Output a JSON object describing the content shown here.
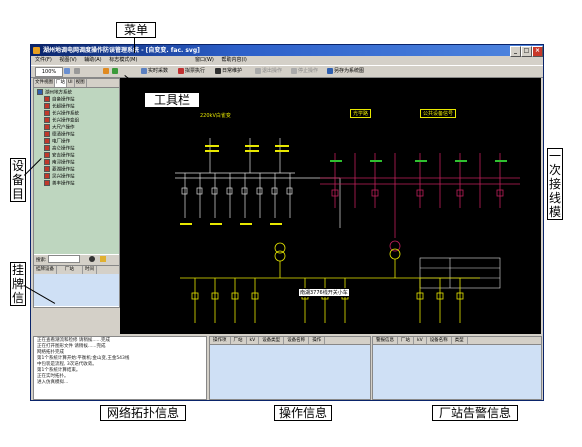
{
  "window": {
    "title": "湖州地调电网调度操作防误管理系统 - [自变变. fac. svg]"
  },
  "menu": [
    "文件(F)",
    "视图(V)",
    "辅助(A)",
    "标志模式(M)",
    "窗口(W)",
    "帮助内容(I)"
  ],
  "toolbar": {
    "zoom": "100%",
    "buttons": [
      "实时采数",
      "拟票执行",
      "日常维护",
      "退出操作",
      "停止操作",
      "另存为系统图"
    ]
  },
  "left_panel": {
    "tabs": [
      "文件视图",
      "厂站",
      "UI",
      "视图"
    ],
    "tree_root": "湖州地方系统",
    "tree_items": [
      "自备操作站",
      "长超操作站",
      "长兴操作系统",
      "长兴操作变组",
      "大尺户操作",
      "德清操作站",
      "电厂操作",
      "高仑操作站",
      "安吉操作站",
      "南浔操作站",
      "菱湖操作站",
      "吴兴操作站",
      "善丰操作站"
    ],
    "search_label": "搜索:",
    "tag_columns": [
      "挂牌设备",
      "厂站",
      "时间"
    ]
  },
  "diagram": {
    "title_left": "220kV白雀变",
    "tag_mid": "光学路",
    "tag_right": "公共设备信号",
    "popup": "南湖3776线开关小车"
  },
  "log": {
    "lines": [
      "正在查看潮流和检修 请稍候......完成",
      "正在打开图形文件 请稍候......完成",
      "网络拓扑完成",
      "第1个系统计算开始:平衡机:金山变,王金543线",
      "中包装是流程, 3次迭代收敛。",
      "第1个系统计算结束。",
      "正在实时拓扑。",
      "进入仿真模拟..."
    ]
  },
  "op_table": {
    "columns": [
      "操作项",
      "厂站",
      "kV",
      "设备类型",
      "设备名称",
      "操作"
    ]
  },
  "alarm_table": {
    "columns": [
      "警报信息",
      "厂站",
      "kV",
      "设备名称",
      "类型"
    ]
  },
  "callouts": {
    "menu": "菜单",
    "toolbar": "工具栏",
    "device_tree": "设备目",
    "primary_diagram": "一次接线模",
    "tag_info": "挂牌信",
    "topology_info": "网络拓扑信息",
    "operation_info": "操作信息",
    "alarm_info": "厂站告警信息"
  },
  "colors": {
    "canvas_bg": "#000000",
    "bus_yellow": "#e8e800",
    "bus_magenta": "#c0205a",
    "bus_white": "#e0e0e0",
    "panel_green": "#bed6bf",
    "panel_blue": "#cfe0f5"
  }
}
